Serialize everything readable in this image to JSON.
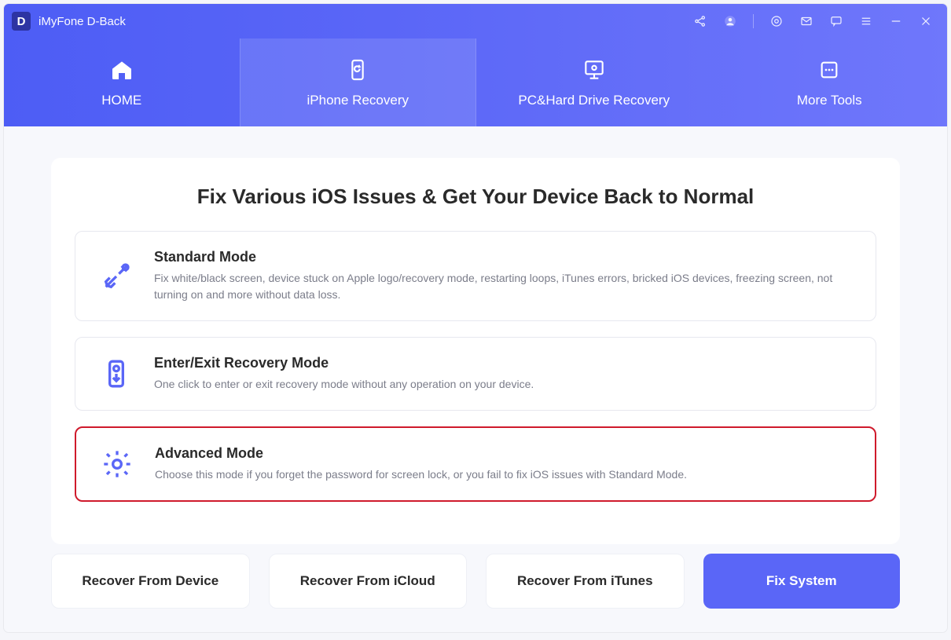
{
  "window": {
    "title": "iMyFone D-Back",
    "logo_letter": "D"
  },
  "nav": {
    "home": "HOME",
    "iphone_recovery": "iPhone Recovery",
    "pc_hard": "PC&Hard Drive Recovery",
    "more_tools": "More Tools"
  },
  "main": {
    "title": "Fix Various iOS Issues & Get Your Device Back to Normal",
    "modes": {
      "standard": {
        "title": "Standard Mode",
        "desc": "Fix white/black screen, device stuck on Apple logo/recovery mode, restarting loops, iTunes errors, bricked iOS devices, freezing screen, not turning on and more without data loss."
      },
      "recovery": {
        "title": "Enter/Exit Recovery Mode",
        "desc": "One click to enter or exit recovery mode without any operation on your device."
      },
      "advanced": {
        "title": "Advanced Mode",
        "desc": "Choose this mode if you forget the password for screen lock, or you fail to fix iOS issues with Standard Mode."
      }
    }
  },
  "bottom": {
    "device": "Recover From Device",
    "icloud": "Recover From iCloud",
    "itunes": "Recover From iTunes",
    "fix": "Fix System"
  }
}
